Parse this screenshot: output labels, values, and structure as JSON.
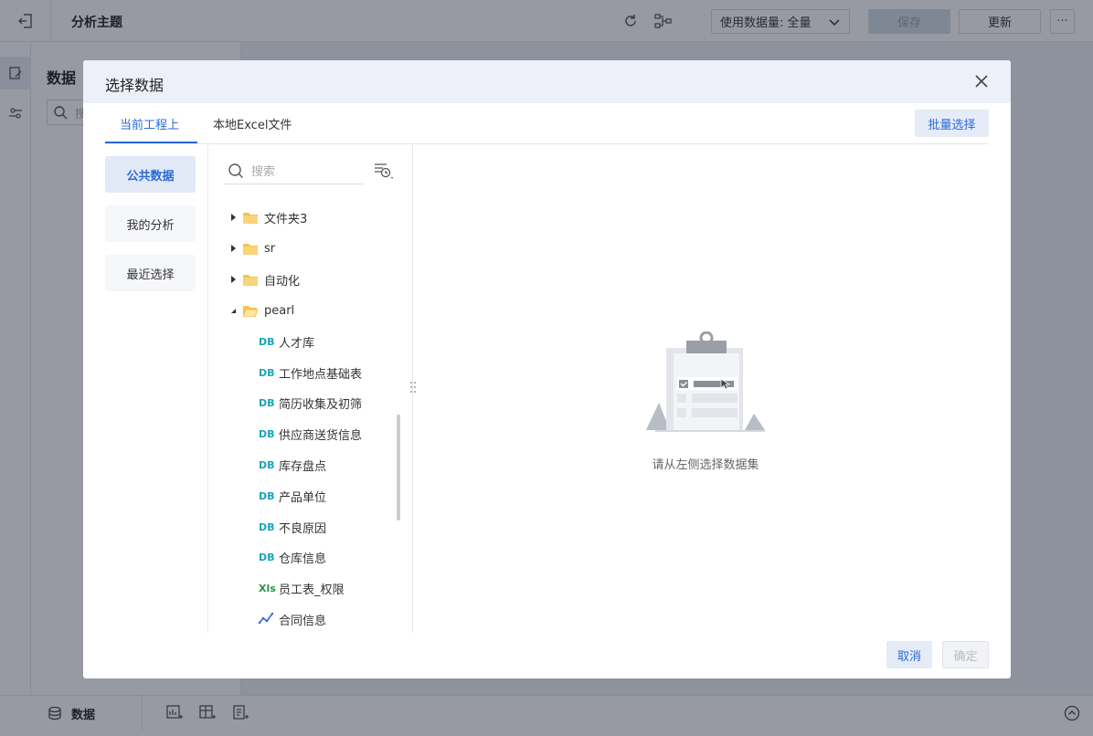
{
  "app": {
    "title": "分析主题",
    "data_volume_label": "使用数据量: 全量",
    "save_label": "保存",
    "update_label": "更新",
    "more_label": "···",
    "data_panel_title": "数据",
    "panel_search_placeholder": "搜",
    "bottom_tab_label": "数据"
  },
  "modal": {
    "title": "选择数据",
    "tabs": [
      {
        "label": "当前工程上",
        "active": true
      },
      {
        "label": "本地Excel文件",
        "active": false
      }
    ],
    "batch_select_label": "批量选择",
    "categories": [
      {
        "label": "公共数据",
        "active": true
      },
      {
        "label": "我的分析",
        "active": false
      },
      {
        "label": "最近选择",
        "active": false
      }
    ],
    "search_placeholder": "搜索",
    "tree": [
      {
        "label": "文件夹3",
        "type": "folder",
        "expanded": false
      },
      {
        "label": "sr",
        "type": "folder",
        "expanded": false
      },
      {
        "label": "自动化",
        "type": "folder",
        "expanded": false
      },
      {
        "label": "pearl",
        "type": "folder",
        "expanded": true
      },
      {
        "label": "人才库",
        "type": "db",
        "icon_text": "DB"
      },
      {
        "label": "工作地点基础表",
        "type": "db",
        "icon_text": "DB"
      },
      {
        "label": "简历收集及初筛",
        "type": "db",
        "icon_text": "DB"
      },
      {
        "label": "供应商送货信息",
        "type": "db",
        "icon_text": "DB"
      },
      {
        "label": "库存盘点",
        "type": "db",
        "icon_text": "DB"
      },
      {
        "label": "产品单位",
        "type": "db",
        "icon_text": "DB"
      },
      {
        "label": "不良原因",
        "type": "db",
        "icon_text": "DB"
      },
      {
        "label": "仓库信息",
        "type": "db",
        "icon_text": "DB"
      },
      {
        "label": "员工表_权限",
        "type": "xls",
        "icon_text": "Xls"
      },
      {
        "label": "合同信息",
        "type": "analysis"
      }
    ],
    "empty_text": "请从左侧选择数据集",
    "cancel_label": "取消",
    "ok_label": "确定"
  },
  "colors": {
    "accent": "#2a6ad8",
    "db_icon": "#1aa3b8",
    "xls_icon": "#2e8f4e",
    "folder": "#f5c24b"
  }
}
